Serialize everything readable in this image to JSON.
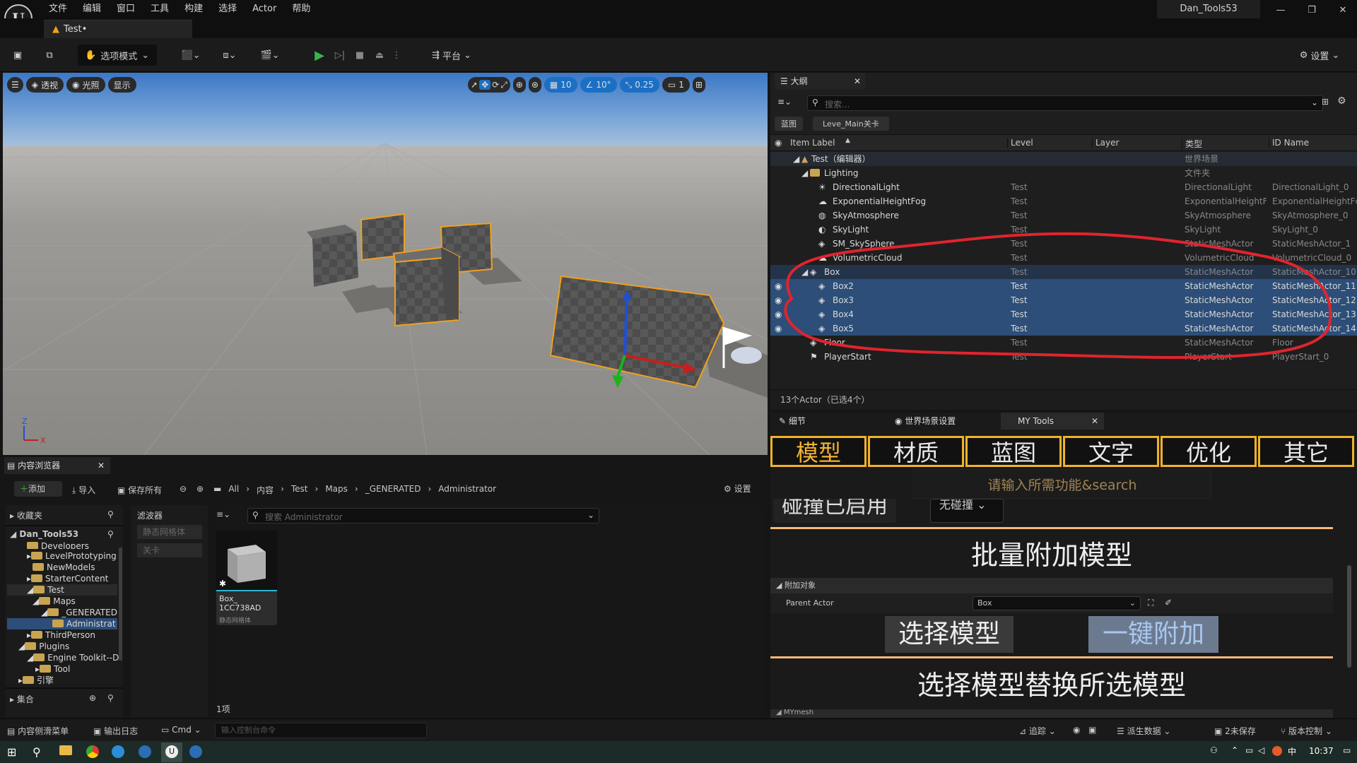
{
  "app": {
    "project_name": "Dan_Tools53",
    "level_tab": "Test•"
  },
  "menu": [
    "文件",
    "编辑",
    "窗口",
    "工具",
    "构建",
    "选择",
    "Actor",
    "帮助"
  ],
  "toolbar": {
    "mode": "选项模式",
    "platform": "平台",
    "settings": "设置"
  },
  "viewport": {
    "left_pills": [
      "透视",
      "光照",
      "显示"
    ],
    "grid_snap": "10",
    "rot_snap": "10°",
    "scale_snap": "0.25",
    "cam_speed": "1"
  },
  "outliner": {
    "title": "大纲",
    "search_placeholder": "搜索...",
    "filter_tags": [
      "蓝图",
      "Leve_Main关卡"
    ],
    "columns": [
      "Item Label",
      "Level",
      "Layer",
      "类型",
      "ID Name"
    ],
    "rows": [
      {
        "label": "Test（编辑器）",
        "level": "",
        "type": "世界场景",
        "id": ""
      },
      {
        "label": "Lighting",
        "level": "",
        "type": "文件夹",
        "id": ""
      },
      {
        "label": "DirectionalLight",
        "level": "Test",
        "type": "DirectionalLight",
        "id": "DirectionalLight_0"
      },
      {
        "label": "ExponentialHeightFog",
        "level": "Test",
        "type": "ExponentialHeightFc",
        "id": "ExponentialHeightFc"
      },
      {
        "label": "SkyAtmosphere",
        "level": "Test",
        "type": "SkyAtmosphere",
        "id": "SkyAtmosphere_0"
      },
      {
        "label": "SkyLight",
        "level": "Test",
        "type": "SkyLight",
        "id": "SkyLight_0"
      },
      {
        "label": "SM_SkySphere",
        "level": "Test",
        "type": "StaticMeshActor",
        "id": "StaticMeshActor_1"
      },
      {
        "label": "VolumetricCloud",
        "level": "Test",
        "type": "VolumetricCloud",
        "id": "VolumetricCloud_0"
      },
      {
        "label": "Box",
        "level": "Test",
        "type": "StaticMeshActor",
        "id": "StaticMeshActor_10"
      },
      {
        "label": "Box2",
        "level": "Test",
        "type": "StaticMeshActor",
        "id": "StaticMeshActor_11"
      },
      {
        "label": "Box3",
        "level": "Test",
        "type": "StaticMeshActor",
        "id": "StaticMeshActor_12"
      },
      {
        "label": "Box4",
        "level": "Test",
        "type": "StaticMeshActor",
        "id": "StaticMeshActor_13"
      },
      {
        "label": "Box5",
        "level": "Test",
        "type": "StaticMeshActor",
        "id": "StaticMeshActor_14"
      },
      {
        "label": "Floor",
        "level": "Test",
        "type": "StaticMeshActor",
        "id": "Floor"
      },
      {
        "label": "PlayerStart",
        "level": "Test",
        "type": "PlayerStart",
        "id": "PlayerStart_0"
      }
    ],
    "status": "13个Actor（已选4个）"
  },
  "details": {
    "tabs": [
      "细节",
      "世界场景设置",
      "MY Tools"
    ],
    "category_buttons": [
      "模型",
      "材质",
      "蓝图",
      "文字",
      "优化",
      "其它"
    ],
    "search_hint": "请输入所需功能&search",
    "collision_label": "碰撞已启用",
    "collision_value": "无碰撞",
    "batch_attach_title": "批量附加模型",
    "attach_section": "附加对象",
    "parent_actor_label": "Parent Actor",
    "parent_actor_value": "Box",
    "select_model_btn": "选择模型",
    "one_click_attach_btn": "一键附加",
    "replace_title": "选择模型替换所选模型",
    "bottom_section": "MYmesh"
  },
  "content_browser": {
    "title": "内容浏览器",
    "add": "添加",
    "import": "导入",
    "save_all": "保存所有",
    "breadcrumb": [
      "All",
      "内容",
      "Test",
      "Maps",
      "_GENERATED",
      "Administrator"
    ],
    "settings": "设置",
    "favorites": "收藏夹",
    "root": "Dan_Tools53",
    "tree": [
      "Developers",
      "LevelPrototyping",
      "NewModels",
      "StarterContent",
      "Test",
      "Maps",
      "_GENERATED",
      "Administrat",
      "ThirdPerson",
      "Plugins",
      "Engine Toolkit--D",
      "Tool",
      "引擎"
    ],
    "collections": "集合",
    "filters_title": "滤波器",
    "filters": [
      "静态网格体",
      "关卡"
    ],
    "search_placeholder": "搜索 Administrator",
    "asset_name": "Box_\n1CC738AD",
    "asset_type": "静态网格体",
    "item_count": "1项"
  },
  "statusbar": {
    "drawer": "内容侧滑菜单",
    "output_log": "输出日志",
    "cmd": "Cmd",
    "console_placeholder": "输入控制台命令",
    "trace": "追踪",
    "derived": "派生数据",
    "unsaved": "2未保存",
    "source_control": "版本控制"
  },
  "taskbar": {
    "time": "10:37"
  }
}
